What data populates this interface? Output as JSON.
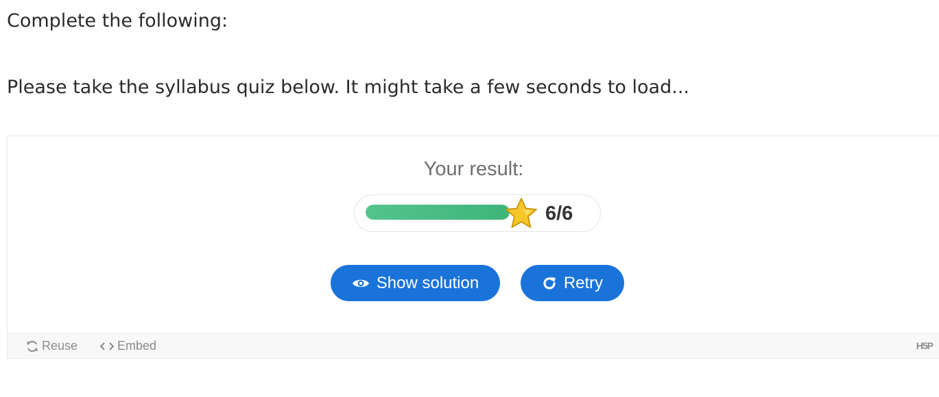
{
  "intro": {
    "heading": "Complete the following:",
    "text": "Please take the syllabus quiz below. It might take a few seconds to load..."
  },
  "quiz": {
    "result_label": "Your result:",
    "score": 6,
    "max_score": 6,
    "score_text": "6/6",
    "progress_fraction": 1.0,
    "buttons": {
      "show_solution": {
        "label": "Show solution",
        "icon": "eye-icon"
      },
      "retry": {
        "label": "Retry",
        "icon": "retry-icon"
      }
    },
    "colors": {
      "button": "#1a73d9",
      "progress": "#4cc085",
      "star": "#f7c72a"
    }
  },
  "footer": {
    "reuse": {
      "label": "Reuse",
      "icon": "reuse-icon"
    },
    "embed": {
      "label": "Embed",
      "icon": "embed-icon"
    },
    "logo": "H5P"
  }
}
